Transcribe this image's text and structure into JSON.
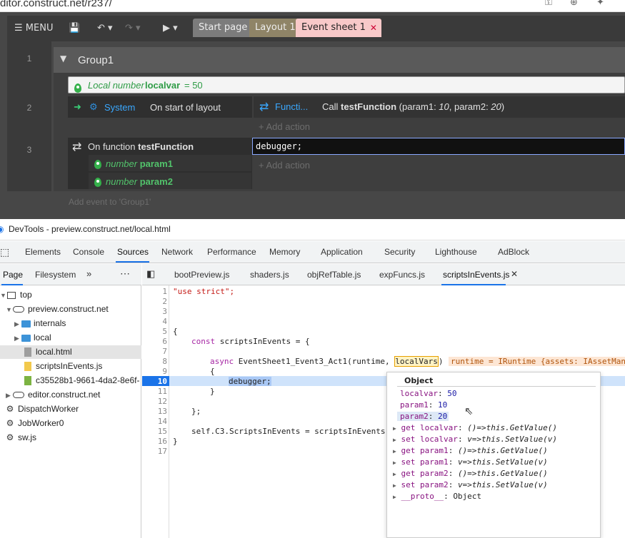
{
  "browser": {
    "url": "ditor.construct.net/r237/"
  },
  "editor": {
    "menu_label": "MENU",
    "tabs": [
      {
        "label": "Start page"
      },
      {
        "label": "Layout 1"
      },
      {
        "label": "Event sheet 1"
      }
    ],
    "close_glyph": "✕",
    "lines": [
      "1",
      "2",
      "3"
    ],
    "group_title": "Group1",
    "local_var": {
      "prefix": "Local number",
      "name": "localvar",
      "value": "= 50"
    },
    "event2": {
      "object": "System",
      "condition": "On start of layout",
      "action_object": "Functi...",
      "action_prefix": "Call",
      "action_fn": "testFunction",
      "action_args_a": "(param1: ",
      "param1": "10",
      "action_args_b": ", param2: ",
      "param2": "20",
      "action_args_c": ")",
      "add_action": "+ Add action"
    },
    "event3": {
      "condition_prefix": "On function",
      "fn_name": "testFunction",
      "params": [
        {
          "type": "number",
          "name": "param1"
        },
        {
          "type": "number",
          "name": "param2"
        }
      ],
      "script": "debugger;",
      "add_action": "+ Add action"
    },
    "add_event": "Add event to 'Group1'"
  },
  "devtools": {
    "title": "DevTools - preview.construct.net/local.html",
    "nav": [
      "Elements",
      "Console",
      "Sources",
      "Network",
      "Performance",
      "Memory",
      "Application",
      "Security",
      "Lighthouse",
      "AdBlock"
    ],
    "active_nav": "Sources",
    "left_tabs": [
      "Page",
      "Filesystem"
    ],
    "tree": [
      "top",
      "preview.construct.net",
      "internals",
      "local",
      "local.html",
      "scriptsInEvents.js",
      "c35528b1-9661-4da2-8e6f-",
      "editor.construct.net",
      "DispatchWorker",
      "JobWorker0",
      "sw.js"
    ],
    "file_tabs": [
      "bootPreview.js",
      "shaders.js",
      "objRefTable.js",
      "expFuncs.js",
      "scriptsInEvents.js"
    ],
    "code": {
      "line_numbers": [
        "1",
        "2",
        "3",
        "4",
        "5",
        "6",
        "7",
        "8",
        "9",
        "10",
        "11",
        "12",
        "13",
        "14",
        "15",
        "16",
        "17"
      ],
      "l1": "\"use strict\";",
      "l5": "{",
      "l6a": "const",
      "l6b": " scriptsInEvents = {",
      "l8a": "async",
      "l8b": " EventSheet1_Event3_Act1(runtime, ",
      "l8c": "localVars",
      "l8d": ")",
      "l8hint": "runtime = IRuntime {assets: IAssetMan",
      "l9": "{",
      "l10": "debugger;",
      "l11": "}",
      "l13": "};",
      "l15": "self.C3.ScriptsInEvents = scriptsInEvents;",
      "l16": "}"
    },
    "popover": {
      "title": "Object",
      "rows": [
        {
          "k": "localvar",
          "v": "50"
        },
        {
          "k": "param1",
          "v": "10"
        },
        {
          "k": "param2",
          "v": "20"
        }
      ],
      "accessors": [
        {
          "k": "get localvar",
          "v": "()=>this.GetValue()"
        },
        {
          "k": "set localvar",
          "v": "v=>this.SetValue(v)"
        },
        {
          "k": "get param1",
          "v": "()=>this.GetValue()"
        },
        {
          "k": "set param1",
          "v": "v=>this.SetValue(v)"
        },
        {
          "k": "get param2",
          "v": "()=>this.GetValue()"
        },
        {
          "k": "set param2",
          "v": "v=>this.SetValue(v)"
        }
      ],
      "proto_k": "__proto__",
      "proto_v": "Object"
    }
  }
}
